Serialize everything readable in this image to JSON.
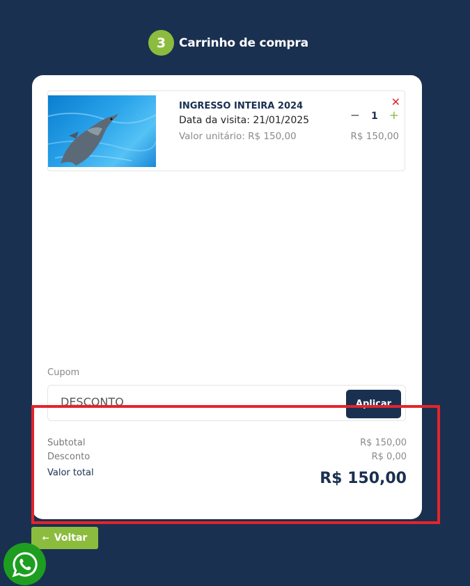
{
  "step": {
    "number": "3",
    "title": "Carrinho de compra"
  },
  "cart": {
    "item": {
      "name": "INGRESSO INTEIRA 2024",
      "visit_date": "Data da visita: 21/01/2025",
      "unit_price": "Valor unitário: R$ 150,00",
      "quantity": "1",
      "price": "R$ 150,00",
      "remove_icon": "close-icon",
      "minus_icon": "minus-icon",
      "plus_icon": "plus-icon",
      "image": "dolphin-photo"
    }
  },
  "coupon": {
    "label": "Cupom",
    "placeholder": "DESCONTO",
    "apply_label": "Aplicar"
  },
  "summary": {
    "subtotal_label": "Subtotal",
    "subtotal_value": "R$ 150,00",
    "discount_label": "Desconto",
    "discount_value": "R$ 0,00",
    "total_label": "Valor total",
    "total_value": "R$ 150,00"
  },
  "footer": {
    "back_label": "Voltar",
    "back_icon": "arrow-left-icon",
    "whatsapp_icon": "whatsapp-icon"
  },
  "colors": {
    "background": "#1a3050",
    "accent_green": "#8cbc3e",
    "primary_navy": "#1a3050",
    "remove_red": "#e3242b",
    "highlight_red": "#e3242b",
    "whatsapp_green": "#1d9e20"
  }
}
